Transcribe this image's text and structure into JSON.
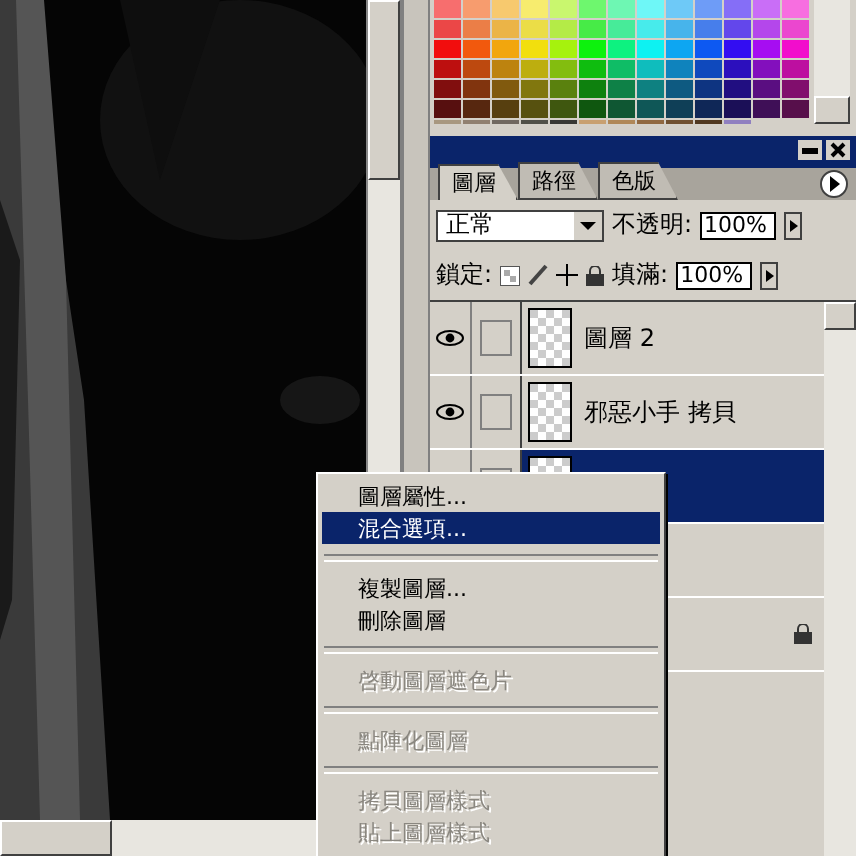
{
  "layers_panel": {
    "tabs": [
      {
        "label": "圖層",
        "selected": true
      },
      {
        "label": "路徑",
        "selected": false
      },
      {
        "label": "色版",
        "selected": false
      }
    ],
    "blend_mode": "正常",
    "opacity_label": "不透明:",
    "opacity": "100%",
    "lock_label": "鎖定:",
    "fill_label": "填滿:",
    "fill": "100%",
    "layers": [
      {
        "kind": "layer",
        "name": "圖層 2",
        "visible": true,
        "selected": false
      },
      {
        "kind": "layer",
        "name": "邪惡小手 拷貝",
        "visible": true,
        "selected": false
      },
      {
        "kind": "layer",
        "selected": true
      },
      {
        "kind": "covered",
        "selected": false
      },
      {
        "kind": "covered",
        "selected": false,
        "locked": true
      }
    ]
  },
  "context_menu": {
    "items": [
      {
        "kind": "item",
        "label": "圖層屬性...",
        "disabled": false,
        "selected": false
      },
      {
        "kind": "item",
        "label": "混合選項...",
        "disabled": false,
        "selected": true
      },
      {
        "kind": "separator"
      },
      {
        "kind": "item",
        "label": "複製圖層...",
        "disabled": false,
        "selected": false
      },
      {
        "kind": "item",
        "label": "刪除圖層",
        "disabled": false,
        "selected": false
      },
      {
        "kind": "separator"
      },
      {
        "kind": "item",
        "label": "啓動圖層遮色片",
        "disabled": true,
        "selected": false
      },
      {
        "kind": "separator"
      },
      {
        "kind": "item",
        "label": "點陣化圖層",
        "disabled": true,
        "selected": false
      },
      {
        "kind": "separator"
      },
      {
        "kind": "item",
        "label": "拷貝圖層樣式",
        "disabled": true,
        "selected": false
      },
      {
        "kind": "item",
        "label": "貼上圖層樣式",
        "disabled": true,
        "selected": false
      }
    ]
  }
}
